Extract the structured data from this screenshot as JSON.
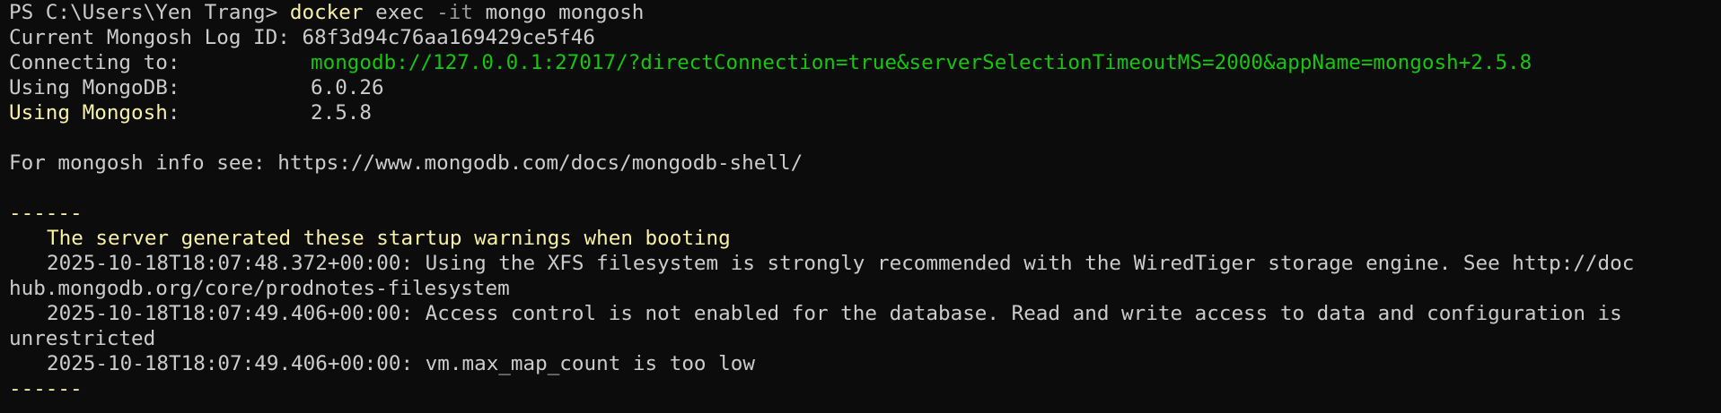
{
  "window": {
    "background": "#0c0c0c",
    "foreground": "#cccccc",
    "accent_yellow": "#f9f1a5",
    "accent_green": "#16c60c"
  },
  "prompt": {
    "path": "PS C:\\Users\\Yen Trang>",
    "command_name": "docker",
    "command_rest": "exec",
    "command_flag": "-it",
    "command_args": "mongo mongosh"
  },
  "log": {
    "log_id_label": "Current Mongosh Log ID:",
    "log_id_value": "68f3d94c76aa169429ce5f46",
    "connecting_label": "Connecting to:",
    "connecting_value": "mongodb://127.0.0.1:27017/?directConnection=true&serverSelectionTimeoutMS=2000&appName=mongosh+2.5.8",
    "mongodb_label": "Using MongoDB:",
    "mongodb_value": "6.0.26",
    "mongosh_label": "Using Mongosh",
    "mongosh_colon": ":",
    "mongosh_value": "2.5.8",
    "info_text": "For mongosh info see: https://www.mongodb.com/docs/mongodb-shell/"
  },
  "warnings": {
    "separator": "------",
    "header": "The server generated these startup warnings when booting",
    "items": [
      {
        "line1": "2025-10-18T18:07:48.372+00:00: Using the XFS filesystem is strongly recommended with the WiredTiger storage engine. See http://doc",
        "line2": "hub.mongodb.org/core/prodnotes-filesystem"
      },
      {
        "line1": "2025-10-18T18:07:49.406+00:00: Access control is not enabled for the database. Read and write access to data and configuration is",
        "line2": "unrestricted"
      },
      {
        "line1": "2025-10-18T18:07:49.406+00:00: vm.max_map_count is too low",
        "line2": ""
      }
    ]
  }
}
